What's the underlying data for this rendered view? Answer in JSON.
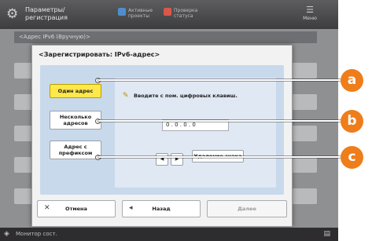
{
  "topbar": {
    "title": "Параметры/ регистрация",
    "item1": "Активные проекты",
    "item2": "Проверка статуса",
    "menu": "Меню"
  },
  "background": {
    "header": "<Адрес IPv6 (Вручную)>"
  },
  "dialog": {
    "title": "<Зарегистрировать: IPv6-адрес>",
    "buttons": [
      {
        "label": "Один адрес"
      },
      {
        "label": "Несколько адресов"
      },
      {
        "label": "Адрес с префиксом"
      }
    ],
    "hint": "Вводите с пом. цифровых клавиш.",
    "ip_value": "0 . 0 . 0 . 0",
    "arrow_left": "◀",
    "arrow_right": "▶",
    "delete_label": "Удаление знака",
    "footer": {
      "cancel": "Отмена",
      "back": "Назад",
      "next": "Далее"
    }
  },
  "callouts": [
    "a",
    "b",
    "c"
  ],
  "statusbar": {
    "label": "Монитор сост."
  },
  "colors": {
    "accent": "#ef7d1a",
    "selected": "#ffe84a"
  }
}
